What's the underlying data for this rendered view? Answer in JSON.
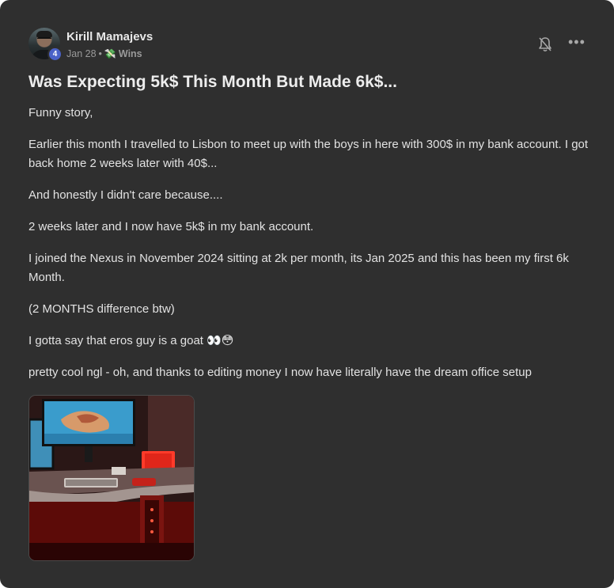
{
  "post": {
    "author": {
      "name": "Kirill Mamajevs",
      "level": "4"
    },
    "meta": {
      "date": "Jan 28",
      "separator": "•",
      "category_icon": "💸",
      "category": "Wins"
    },
    "actions": {
      "bell_icon": "bell-icon",
      "more_label": "•••"
    },
    "title": "Was Expecting 5k$ This Month But Made 6k$...",
    "paragraphs": [
      "Funny story,",
      "Earlier this month I travelled to Lisbon to meet up with the boys in here with 300$ in my bank account. I got back home 2 weeks later with 40$...",
      "And honestly I didn't care because....",
      "2 weeks later and I now have 5k$ in my bank account.",
      "I joined the Nexus in November 2024 sitting at 2k per month, its Jan 2025 and this has been my first 6k Month.",
      "(2 MONTHS difference btw)",
      "I gotta say that eros guy is a goat 👀😳",
      "pretty cool ngl - oh, and thanks to editing money I now have literally have the dream office setup"
    ],
    "attachment": {
      "type": "image",
      "subject": "office-setup-photo"
    }
  },
  "colors": {
    "card_bg": "#2f2f2f",
    "text": "#e2e2e2",
    "muted": "#9a9a9a",
    "badge": "#4a62c8"
  }
}
